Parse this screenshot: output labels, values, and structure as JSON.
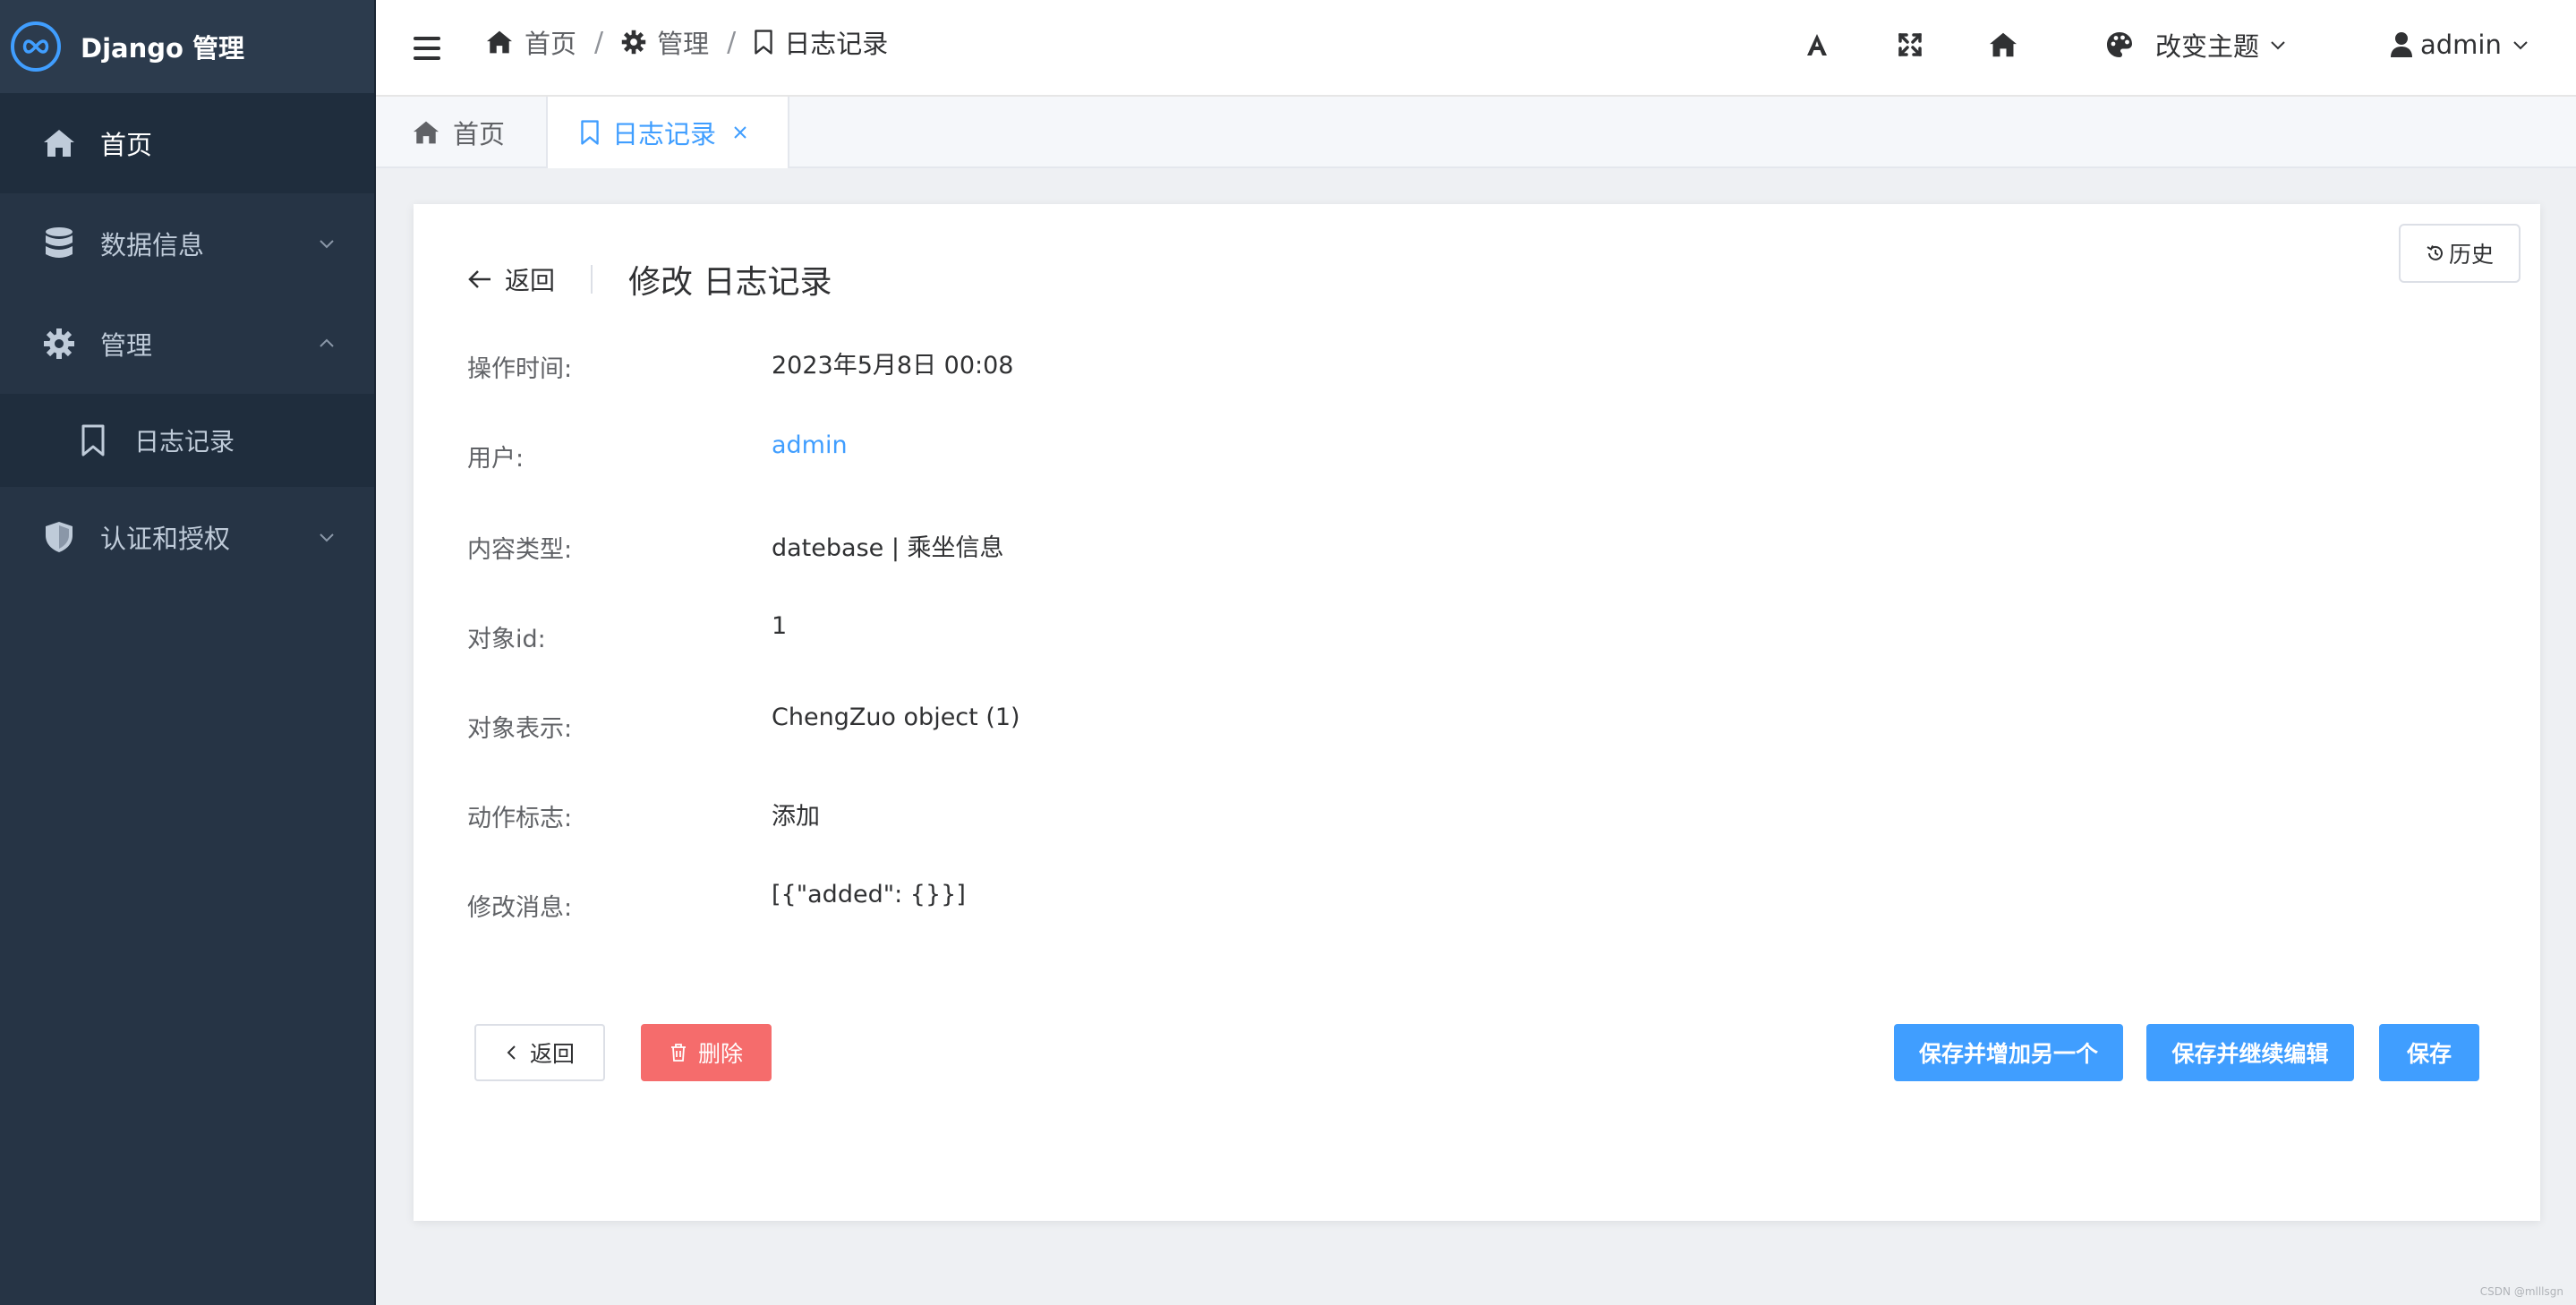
{
  "sidebar": {
    "brand": "Django 管理",
    "items": [
      {
        "label": "首页"
      },
      {
        "label": "数据信息"
      },
      {
        "label": "管理"
      },
      {
        "label": "日志记录"
      },
      {
        "label": "认证和授权"
      }
    ]
  },
  "header": {
    "breadcrumb": [
      "首页",
      "管理",
      "日志记录"
    ],
    "separator": "/",
    "theme_label": "改变主题",
    "user": "admin"
  },
  "tabs": [
    {
      "label": "首页"
    },
    {
      "label": "日志记录"
    }
  ],
  "page": {
    "back_label": "返回",
    "title": "修改 日志记录",
    "history_label": "历史",
    "fields": [
      {
        "label": "操作时间:",
        "value": "2023年5月8日 00:08"
      },
      {
        "label": "用户:",
        "value": "admin"
      },
      {
        "label": "内容类型:",
        "value": "datebase | 乘坐信息"
      },
      {
        "label": "对象id:",
        "value": "1"
      },
      {
        "label": "对象表示:",
        "value": "ChengZuo object (1)"
      },
      {
        "label": "动作标志:",
        "value": "添加"
      },
      {
        "label": "修改消息:",
        "value": "[{\"added\": {}}]"
      }
    ],
    "buttons": {
      "back": "返回",
      "delete": "删除",
      "save_add": "保存并增加另一个",
      "save_continue": "保存并继续编辑",
      "save": "保存"
    }
  },
  "watermark": "CSDN @mlllsgn",
  "colors": {
    "sidebar_bg": "#263445",
    "accent": "#409eff",
    "danger": "#f56c6c"
  }
}
